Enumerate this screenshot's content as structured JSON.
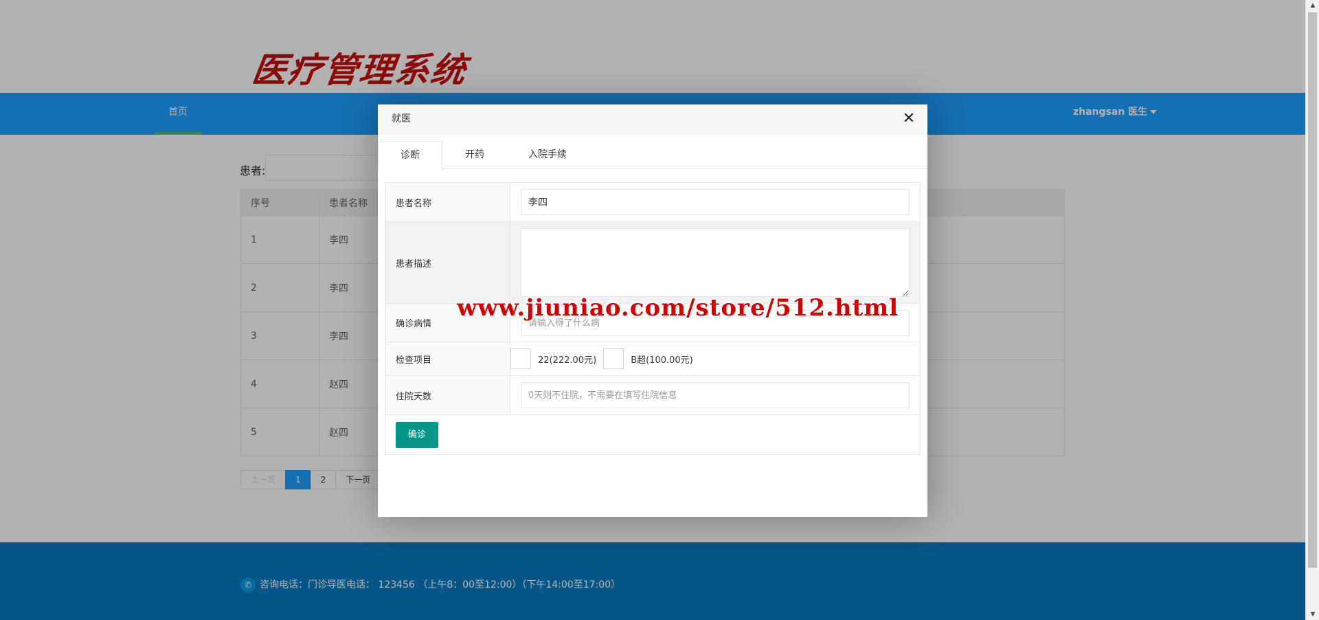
{
  "header": {
    "logo_text": "医疗管理系统"
  },
  "navbar": {
    "home_label": "首页",
    "user_label": "zhangsan 医生"
  },
  "search": {
    "label": "患者:"
  },
  "table": {
    "headers": [
      "序号",
      "患者名称"
    ],
    "rows": [
      {
        "idx": "1",
        "name": "李四"
      },
      {
        "idx": "2",
        "name": "李四"
      },
      {
        "idx": "3",
        "name": "李四"
      },
      {
        "idx": "4",
        "name": "赵四"
      },
      {
        "idx": "5",
        "name": "赵四"
      }
    ]
  },
  "pagination": {
    "prev": "上一页",
    "pages": [
      "1",
      "2"
    ],
    "next": "下一页",
    "current": "1"
  },
  "footer": {
    "contact_text": "咨询电话：门诊导医电话： 123456 （上午8：00至12:00）（下午14:00至17:00）"
  },
  "modal": {
    "title": "就医",
    "tabs": [
      "诊断",
      "开药",
      "入院手续"
    ],
    "active_tab": "诊断",
    "fields": {
      "patient_name": {
        "label": "患者名称",
        "value": "李四"
      },
      "patient_desc": {
        "label": "患者描述",
        "value": ""
      },
      "diagnosis": {
        "label": "确诊病情",
        "placeholder": "请输入得了什么病"
      },
      "exam_items": {
        "label": "检查项目",
        "options": [
          "22(222.00元)",
          "B超(100.00元)"
        ]
      },
      "stay_days": {
        "label": "住院天数",
        "placeholder": "0天则不住院，不需要在填写住院信息"
      }
    },
    "confirm_label": "确诊"
  },
  "watermark": "www.jiuniao.com/store/512.html",
  "colors": {
    "navbar": "#1e9fff",
    "footer": "#0a7bc5",
    "confirm_button": "#009688",
    "logo": "#c81010"
  }
}
